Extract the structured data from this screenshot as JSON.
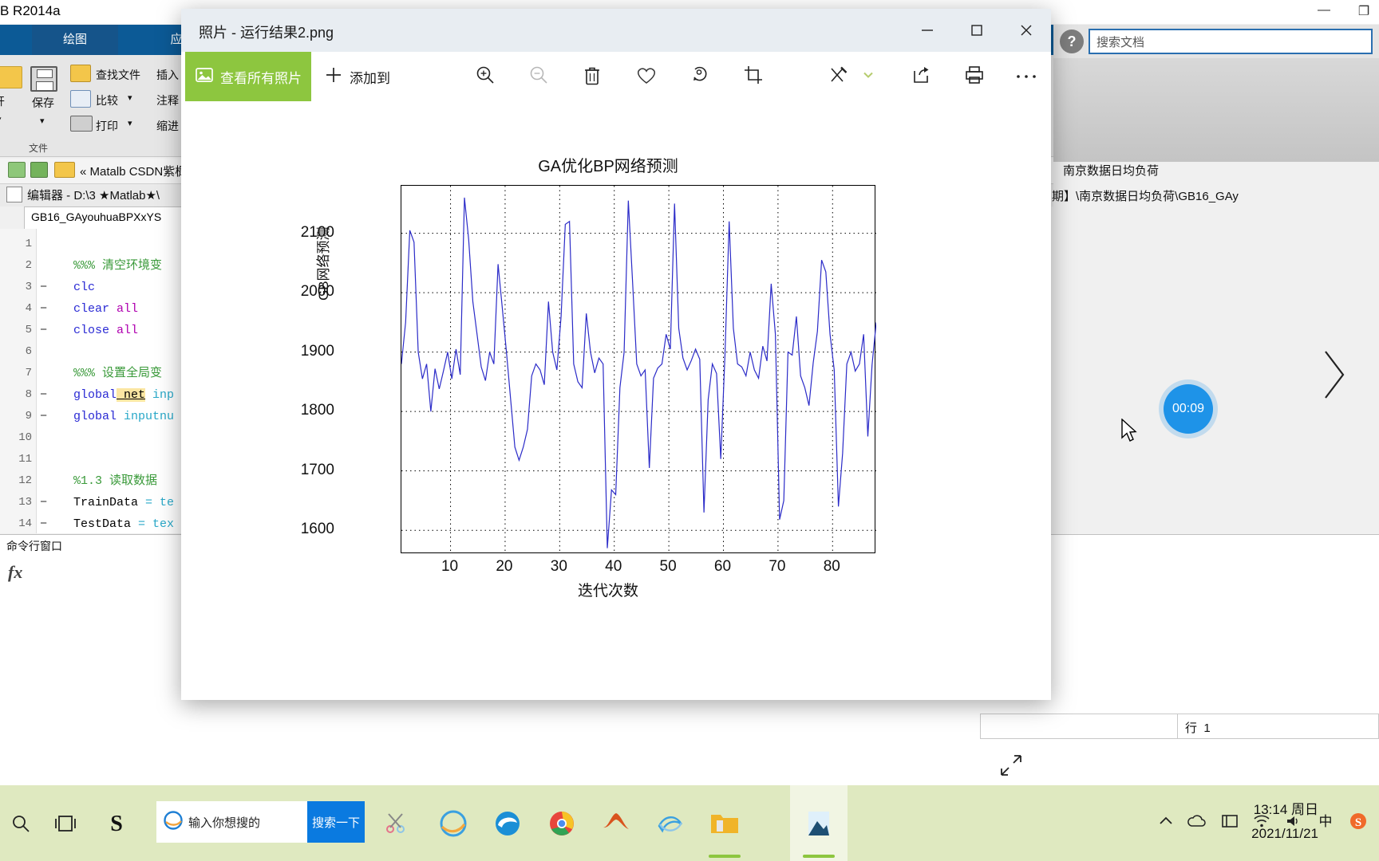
{
  "matlab": {
    "title": "B R2014a",
    "sys": {
      "minimize": "—",
      "maximize": "❐",
      "close": "✕"
    },
    "tabs": [
      {
        "label": "绘图"
      },
      {
        "label": "应用程"
      }
    ],
    "ribbon": {
      "group_label": "文件",
      "buttons": [
        {
          "label": "开"
        },
        {
          "label": "保存"
        },
        {
          "label": "查找文件"
        },
        {
          "label": "比较"
        },
        {
          "label": "打印"
        },
        {
          "label": "插入"
        },
        {
          "label": "注释"
        },
        {
          "label": "缩进"
        }
      ]
    },
    "address": "Matalb CSDN紫枫",
    "editor_bar": "编辑器 - D:\\3 ★Matlab★\\",
    "editor_tab": "GB16_GAyouhuaBPXxYS",
    "code_lines": [
      {
        "no": "1",
        "mark": "",
        "text": ""
      },
      {
        "no": "2",
        "mark": "",
        "text": "%%% 清空环境变"
      },
      {
        "no": "3",
        "mark": "−",
        "text": "clc"
      },
      {
        "no": "4",
        "mark": "−",
        "text": "clear all"
      },
      {
        "no": "5",
        "mark": "−",
        "text": "close all"
      },
      {
        "no": "6",
        "mark": "",
        "text": ""
      },
      {
        "no": "7",
        "mark": "",
        "text": "%%% 设置全局变"
      },
      {
        "no": "8",
        "mark": "−",
        "text": "global net inp"
      },
      {
        "no": "9",
        "mark": "−",
        "text": "global inputnu"
      },
      {
        "no": "10",
        "mark": "",
        "text": ""
      },
      {
        "no": "11",
        "mark": "",
        "text": ""
      },
      {
        "no": "12",
        "mark": "",
        "text": "%1.3 读取数据"
      },
      {
        "no": "13",
        "mark": "−",
        "text": "TrainData = te"
      },
      {
        "no": "14",
        "mark": "−",
        "text": "TestData = tex"
      }
    ],
    "command_window_title": "命令行窗口",
    "fx_label": "fx",
    "help_search_placeholder": "搜索文档",
    "right_panel_line1": "南京数据日均负荷",
    "right_panel_line2": "期】\\南京数据日均负荷\\GB16_GAy",
    "status_row_label": "行",
    "status_row_value": "1"
  },
  "photos": {
    "window_title": "照片 - 运行结果2.png",
    "sys": {
      "minimize": "minimize-icon",
      "maximize": "maximize-icon",
      "close": "close-icon"
    },
    "toolbar": {
      "view_all_label": "查看所有照片",
      "view_all_icon": "photos-icon",
      "add_to_label": "添加到",
      "add_to_icon": "plus-icon",
      "icons": [
        {
          "name": "zoom-in-icon",
          "enabled": true
        },
        {
          "name": "zoom-out-icon",
          "enabled": false
        },
        {
          "name": "delete-icon",
          "enabled": true
        },
        {
          "name": "favorite-icon",
          "enabled": true
        },
        {
          "name": "rotate-icon",
          "enabled": true
        },
        {
          "name": "crop-icon",
          "enabled": true
        },
        {
          "name": "enhance-icon",
          "enabled": true
        },
        {
          "name": "chevron-down-icon",
          "enabled": true
        },
        {
          "name": "share-icon",
          "enabled": true
        },
        {
          "name": "print-icon",
          "enabled": true
        },
        {
          "name": "more-icon",
          "enabled": true
        }
      ]
    },
    "next_arrow_icon": "chevron-right-icon",
    "expand_icon": "expand-icon",
    "green": "#8dc63f",
    "accent": "#1e93e8"
  },
  "overlay": {
    "timer_label": "00:09"
  },
  "taskbar": {
    "search_placeholder": "输入你想搜的",
    "search_button_label": "搜索一下",
    "items": [
      {
        "name": "start-search-icon"
      },
      {
        "name": "task-view-icon"
      },
      {
        "name": "sogou-icon"
      },
      {
        "name": "snip-icon"
      },
      {
        "name": "ie-icon"
      },
      {
        "name": "edge-icon"
      },
      {
        "name": "chrome-icon"
      },
      {
        "name": "matlab-icon"
      },
      {
        "name": "nutstore-icon"
      },
      {
        "name": "explorer-icon"
      },
      {
        "name": "photos-taskbar-icon"
      }
    ],
    "tray": [
      {
        "name": "show-hidden-icon"
      },
      {
        "name": "onedrive-icon"
      },
      {
        "name": "action-center-icon"
      },
      {
        "name": "network-icon"
      },
      {
        "name": "volume-icon"
      },
      {
        "name": "ime-chinese-icon"
      },
      {
        "name": "sogou-tray-icon"
      }
    ],
    "time": "13:14 周日",
    "date": "2021/11/21"
  },
  "chart_data": {
    "type": "line",
    "title": "GA优化BP网络预测",
    "xlabel": "迭代次数",
    "ylabel": "GB网络预测",
    "xticks": [
      10,
      20,
      30,
      40,
      50,
      60,
      70,
      80
    ],
    "yticks": [
      1600,
      1700,
      1800,
      1900,
      2000,
      2100
    ],
    "xlim": [
      1,
      88
    ],
    "ylim": [
      1560,
      2180
    ],
    "grid": true,
    "line_color": "#2b2bc8",
    "legend": null,
    "series": [
      {
        "name": "GB网络预测",
        "values": [
          1880,
          1950,
          2105,
          2085,
          1900,
          1855,
          1880,
          1800,
          1872,
          1838,
          1868,
          1900,
          1855,
          1905,
          1862,
          2160,
          2090,
          1985,
          1930,
          1875,
          1852,
          1900,
          1880,
          2048,
          1975,
          1900,
          1820,
          1740,
          1718,
          1740,
          1770,
          1860,
          1880,
          1870,
          1845,
          1985,
          1900,
          1870,
          1960,
          2115,
          2120,
          1880,
          1850,
          1840,
          1965,
          1900,
          1865,
          1890,
          1880,
          1570,
          1668,
          1660,
          1840,
          1900,
          2155,
          2020,
          1880,
          1860,
          1870,
          1705,
          1856,
          1873,
          1880,
          1930,
          1905,
          2150,
          1940,
          1890,
          1870,
          1886,
          1905,
          1888,
          1630,
          1820,
          1880,
          1864,
          1720,
          1895,
          2120,
          1940,
          1880,
          1875,
          1860,
          1900,
          1870,
          1856,
          1910,
          1885,
          2015,
          1930,
          1618,
          1650,
          1900,
          1895,
          1960,
          1860,
          1840,
          1810,
          1882,
          1935,
          2055,
          2035,
          1930,
          1870,
          1640,
          1730,
          1880,
          1900,
          1868,
          1880,
          1930,
          1758,
          1878,
          1950
        ]
      }
    ]
  }
}
